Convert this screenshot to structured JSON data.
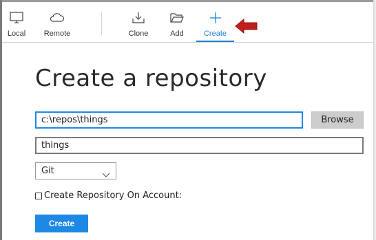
{
  "toolbar": {
    "local_label": "Local",
    "remote_label": "Remote",
    "clone_label": "Clone",
    "add_label": "Add",
    "create_label": "Create",
    "active_tab": "Create",
    "accent_color": "#1e7fd6",
    "annotation_arrow_color": "#c0201a"
  },
  "main": {
    "title": "Create a repository",
    "path_value": "c:\\repos\\things",
    "browse_label": "Browse",
    "name_value": "things",
    "vcs_selected": "Git",
    "account_checkbox_label": "Create Repository On Account:",
    "account_checkbox_checked": false,
    "create_button_label": "Create"
  }
}
